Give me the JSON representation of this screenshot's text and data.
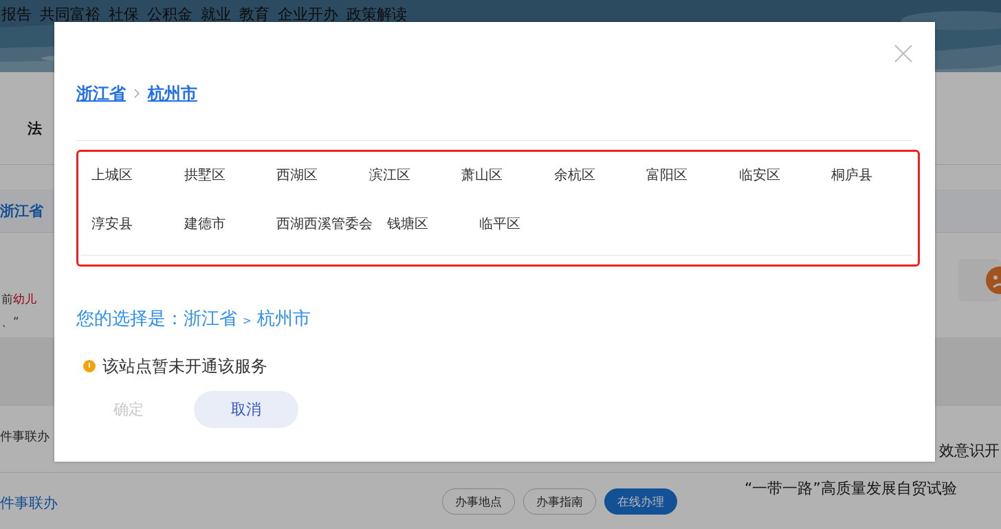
{
  "header": {
    "nav": [
      "报告",
      "共同富裕",
      "社保",
      "公积金",
      "就业",
      "教育",
      "企业开办",
      "政策解读"
    ]
  },
  "page": {
    "section_title": "法",
    "region_tab": "浙江省",
    "notice_lines": [
      {
        "parts": [
          {
            "text": "前",
            "highlight": false
          },
          {
            "text": "幼儿",
            "highlight": true
          }
        ]
      },
      {
        "parts": [
          {
            "text": "、“",
            "highlight": false
          }
        ]
      }
    ],
    "item_title": "件事联办",
    "item_link": "件事联办",
    "item_buttons": [
      {
        "label": "办事地点",
        "selected": false
      },
      {
        "label": "办事指南",
        "selected": false
      },
      {
        "label": "在线办理",
        "selected": true
      }
    ],
    "news": [
      "效意识开",
      "“一带一路”高质量发展自贸试验"
    ]
  },
  "dialog": {
    "breadcrumb": [
      "浙江省",
      "杭州市"
    ],
    "districts": [
      "上城区",
      "拱墅区",
      "西湖区",
      "滨江区",
      "萧山区",
      "余杭区",
      "富阳区",
      "临安区",
      "桐庐县",
      "淳安县",
      "建德市",
      "西湖西溪管委会",
      "钱塘区",
      "临平区"
    ],
    "selection": {
      "label": "您的选择是：",
      "path": [
        "浙江省",
        "杭州市"
      ],
      "separator": ">"
    },
    "warning": "该站点暂未开通该服务",
    "buttons": [
      {
        "label": "确定",
        "disabled": true
      },
      {
        "label": "取消",
        "disabled": false
      }
    ]
  }
}
